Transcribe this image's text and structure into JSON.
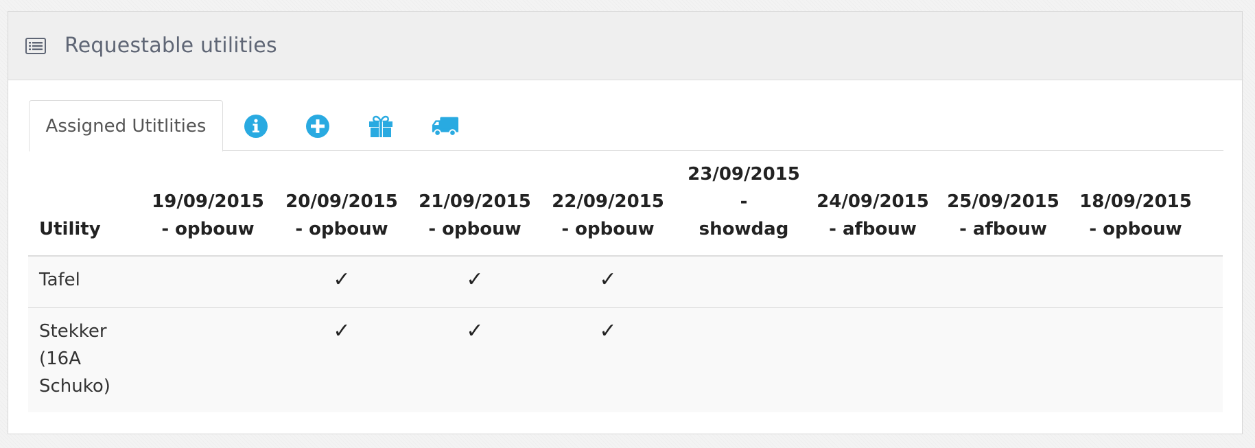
{
  "panel": {
    "title": "Requestable utilities",
    "header_icon": "list-alt-icon"
  },
  "tabs": {
    "active_label": "Assigned Utitlities",
    "icons": [
      {
        "name": "info-icon",
        "color": "#29aae1"
      },
      {
        "name": "plus-icon",
        "color": "#29aae1"
      },
      {
        "name": "gift-icon",
        "color": "#29aae1"
      },
      {
        "name": "truck-icon",
        "color": "#29aae1"
      }
    ]
  },
  "table": {
    "headers": [
      {
        "line1": "Utility",
        "line2": ""
      },
      {
        "line1": "19/09/2015",
        "line2": "- opbouw"
      },
      {
        "line1": "20/09/2015",
        "line2": "- opbouw"
      },
      {
        "line1": "21/09/2015",
        "line2": "- opbouw"
      },
      {
        "line1": "22/09/2015",
        "line2": "- opbouw"
      },
      {
        "line1": "23/09/2015 -",
        "line2": "showdag"
      },
      {
        "line1": "24/09/2015",
        "line2": "- afbouw"
      },
      {
        "line1": "25/09/2015",
        "line2": "- afbouw"
      },
      {
        "line1": "18/09/2015",
        "line2": "- opbouw"
      }
    ],
    "rows": [
      {
        "label_lines": [
          "Tafel"
        ],
        "checks": [
          "",
          "✓",
          "✓",
          "✓",
          "",
          "",
          "",
          ""
        ]
      },
      {
        "label_lines": [
          "Stekker",
          "(16A",
          "Schuko)"
        ],
        "checks": [
          "",
          "✓",
          "✓",
          "✓",
          "",
          "",
          "",
          ""
        ]
      }
    ]
  },
  "colors": {
    "accent": "#29aae1",
    "header_bg": "#efefef",
    "row_bg": "#f9f9f9"
  }
}
